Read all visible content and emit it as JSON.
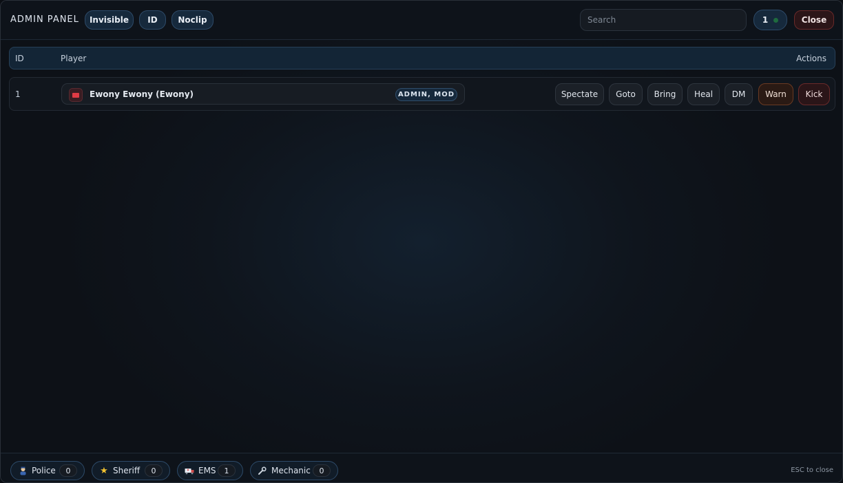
{
  "header": {
    "title": "ADMIN PANEL",
    "toggles": [
      "Invisible",
      "ID",
      "Noclip"
    ],
    "search_placeholder": "Search",
    "player_count": "1",
    "close_label": "Close"
  },
  "table": {
    "columns": {
      "id": "ID",
      "player": "Player",
      "actions": "Actions"
    },
    "rows": [
      {
        "id": "1",
        "name": "Ewony Ewony (Ewony)",
        "roles": "ADMIN, MOD",
        "actions": [
          "Spectate",
          "Goto",
          "Bring",
          "Heal",
          "DM",
          "Warn",
          "Kick"
        ]
      }
    ]
  },
  "footer": {
    "jobs": [
      {
        "label": "Police",
        "count": "0",
        "icon": "police-officer-icon"
      },
      {
        "label": "Sheriff",
        "count": "0",
        "icon": "star-icon"
      },
      {
        "label": "EMS",
        "count": "1",
        "icon": "ambulance-icon"
      },
      {
        "label": "Mechanic",
        "count": "0",
        "icon": "wrench-icon"
      }
    ],
    "hint": "ESC to close"
  },
  "colors": {
    "accent": "#16293c",
    "danger": "#6a2a2a",
    "warn": "#6a3a22",
    "online_dot": "#1f6b3e"
  }
}
